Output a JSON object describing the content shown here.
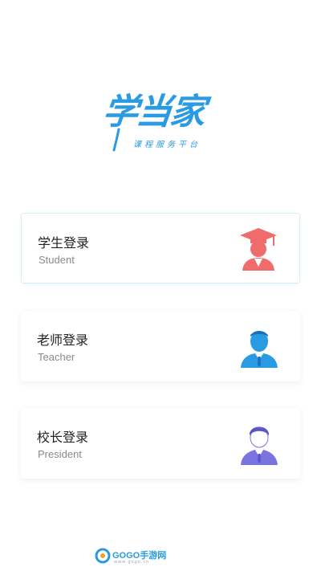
{
  "logo": {
    "title": "学当家",
    "subtitle": "课程服务平台"
  },
  "login_options": [
    {
      "title": "学生登录",
      "subtitle": "Student",
      "icon": "graduate-avatar-icon",
      "color": "#f06b6b"
    },
    {
      "title": "老师登录",
      "subtitle": "Teacher",
      "icon": "teacher-avatar-icon",
      "color": "#2a9be2"
    },
    {
      "title": "校长登录",
      "subtitle": "President",
      "icon": "president-avatar-icon",
      "color": "#7a74e0"
    }
  ],
  "watermark": {
    "text": "GOGO手游网",
    "url_text": "www.gogo.cn"
  }
}
